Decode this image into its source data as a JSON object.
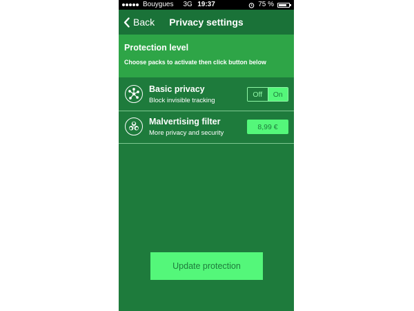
{
  "status_bar": {
    "carrier": "Bouygues",
    "network": "3G",
    "time": "19:37",
    "alarm_icon": "alarm-clock-icon",
    "battery_percent": "75 %",
    "battery_level": 0.75
  },
  "nav": {
    "back_label": "Back",
    "title": "Privacy settings"
  },
  "protection": {
    "heading": "Protection level",
    "instructions": "Choose packs to activate then click button below"
  },
  "packs": [
    {
      "icon": "tracker-block-icon",
      "title": "Basic privacy",
      "description": "Block invisible tracking",
      "toggle": {
        "off_label": "Off",
        "on_label": "On",
        "state": "On"
      }
    },
    {
      "icon": "biohazard-icon",
      "title": "Malvertising filter",
      "description": "More privacy and security",
      "price": "8,99 €"
    }
  ],
  "update_button": "Update protection",
  "colors": {
    "background": "#1e7b3c",
    "navbar": "#1a7238",
    "header_band": "#2ea547",
    "accent": "#54f77a"
  }
}
